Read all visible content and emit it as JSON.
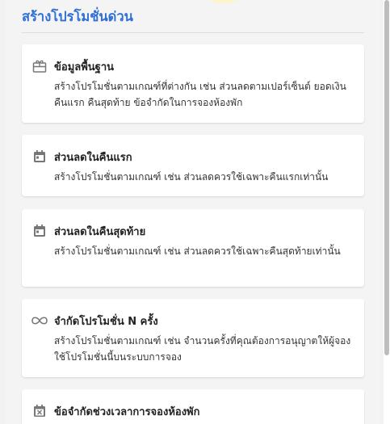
{
  "page": {
    "title": "สร้างโปรโมชั่นด่วน"
  },
  "colors": {
    "title": "#2f6fd6",
    "card_bg": "#ffffff",
    "panel_bg": "#f4f4f4",
    "icon": "#777777"
  },
  "cards": [
    {
      "icon": "gift-icon",
      "title": "ข้อมูลพื้นฐาน",
      "description": "สร้างโปรโมชั่นตามเกณฑ์ที่ต่างกัน เช่น ส่วนลดตามเปอร์เซ็นต์ ยอดเงิน คืนแรก คืนสุดท้าย ข้อจำกัดในการจองห้องพัก"
    },
    {
      "icon": "calendar-icon",
      "title": "ส่วนลดในคืนแรก",
      "description": "สร้างโปรโมชั่นตามเกณฑ์ เช่น ส่วนลดควรใช้เฉพาะคืนแรกเท่านั้น"
    },
    {
      "icon": "calendar-icon",
      "title": "ส่วนลดในคืนสุดท้าย",
      "description": "สร้างโปรโมชั่นตามเกณฑ์ เช่น ส่วนลดควรใช้เฉพาะคืนสุดท้ายเท่านั้น"
    },
    {
      "icon": "infinity-icon",
      "title": "จำกัดโปรโมชั่น N ครั้ง",
      "description": "สร้างโปรโมชั่นตามเกณฑ์ เช่น จำนวนครั้งที่คุณต้องการอนุญาตให้ผู้จองใช้โปรโมชั่นนี้บนระบบการจอง"
    },
    {
      "icon": "calendar-x-icon",
      "title": "ข้อจำกัดช่วงเวลาการจองห้องพัก",
      "description": ""
    }
  ]
}
